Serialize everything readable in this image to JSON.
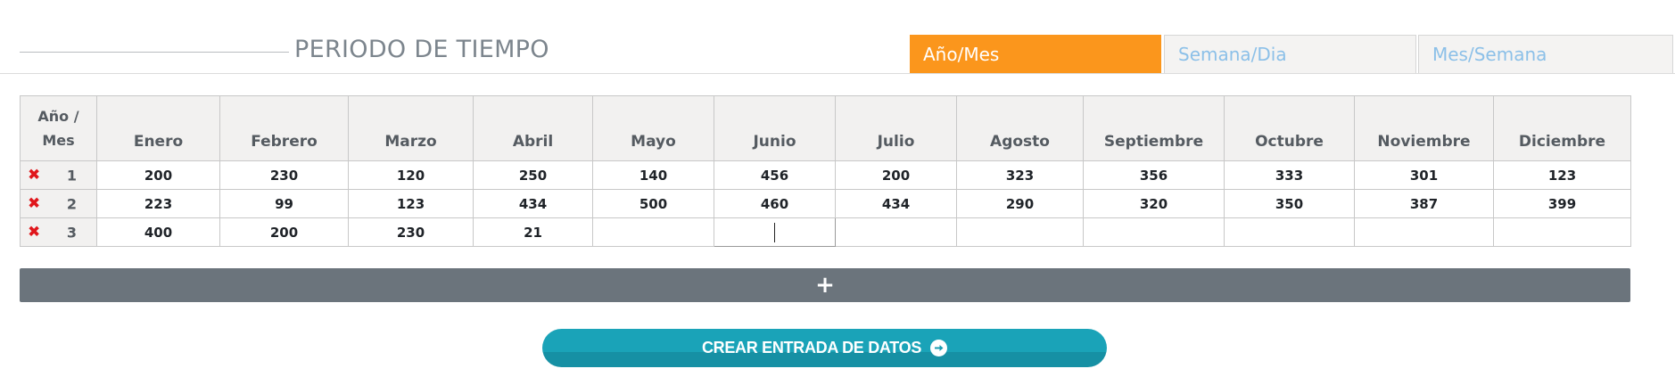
{
  "section": {
    "title": "PERIODO DE TIEMPO"
  },
  "tabs": [
    {
      "label": "Año/Mes",
      "active": true
    },
    {
      "label": "Semana/Dia",
      "active": false
    },
    {
      "label": "Mes/Semana",
      "active": false
    }
  ],
  "table": {
    "corner_label_line1": "Año /",
    "corner_label_line2": "Mes",
    "columns": [
      "Enero",
      "Febrero",
      "Marzo",
      "Abril",
      "Mayo",
      "Junio",
      "Julio",
      "Agosto",
      "Septiembre",
      "Octubre",
      "Noviembre",
      "Diciembre"
    ],
    "rows": [
      {
        "num": "1",
        "values": [
          "200",
          "230",
          "120",
          "250",
          "140",
          "456",
          "200",
          "323",
          "356",
          "333",
          "301",
          "123"
        ]
      },
      {
        "num": "2",
        "values": [
          "223",
          "99",
          "123",
          "434",
          "500",
          "460",
          "434",
          "290",
          "320",
          "350",
          "387",
          "399"
        ]
      },
      {
        "num": "3",
        "values": [
          "400",
          "200",
          "230",
          "21",
          "",
          "",
          "",
          "",
          "",
          "",
          "",
          ""
        ]
      }
    ],
    "delete_icon": "close-x-icon",
    "editing_cell": {
      "row": 3,
      "column": "Junio"
    }
  },
  "add_row": {
    "label": "+"
  },
  "submit": {
    "label": "CREAR ENTRADA DE DATOS",
    "icon": "arrow-circle-right-icon"
  },
  "colors": {
    "accent_tab": "#fb961c",
    "inactive_tab_text": "#8cc0e8",
    "add_bar": "#6b747c",
    "submit_button": "#1aa3b8",
    "delete_icon": "#e0161b"
  }
}
